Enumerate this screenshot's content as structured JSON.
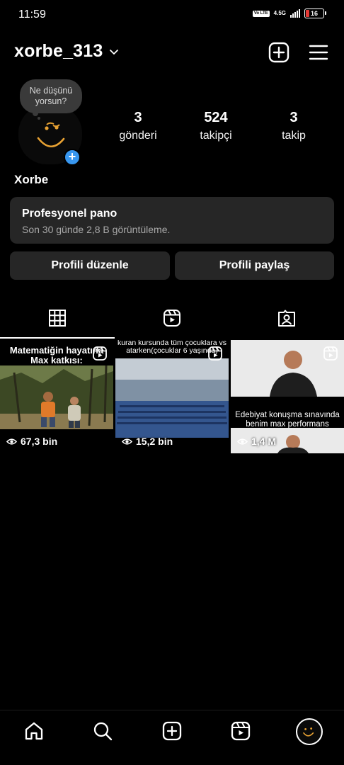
{
  "status": {
    "time": "11:59",
    "net_badge": "Vo LTE",
    "net_type": "4.5G",
    "battery": "16"
  },
  "header": {
    "username": "xorbe_313"
  },
  "profile": {
    "note": "Ne düşünü yorsun?",
    "display_name": "Xorbe",
    "stats": [
      {
        "value": "3",
        "label": "gönderi"
      },
      {
        "value": "524",
        "label": "takipçi"
      },
      {
        "value": "3",
        "label": "takip"
      }
    ]
  },
  "pro_dashboard": {
    "title": "Profesyonel pano",
    "subtitle": "Son 30 günde 2,8 B görüntüleme."
  },
  "buttons": {
    "edit": "Profili düzenle",
    "share": "Profili paylaş"
  },
  "tabs": [
    {
      "name": "grid",
      "icon": "grid-icon"
    },
    {
      "name": "reels",
      "icon": "reels-icon"
    },
    {
      "name": "tagged",
      "icon": "tagged-icon"
    }
  ],
  "posts": [
    {
      "caption_top": "Matematiğin hayatına Max katkısı:",
      "views": "67,3 bin"
    },
    {
      "caption_top": "kuran kursunda tüm çocuklara vs atarken(çocuklar 6 yaşında)",
      "views": "15,2 bin"
    },
    {
      "caption_bottom": "Edebiyat konuşma sınavında benim max performans",
      "views": "1,4 M"
    }
  ],
  "nav": [
    {
      "name": "home",
      "icon": "home-icon"
    },
    {
      "name": "search",
      "icon": "search-icon"
    },
    {
      "name": "create",
      "icon": "plus-square-icon"
    },
    {
      "name": "reels",
      "icon": "reels-icon"
    },
    {
      "name": "profile",
      "icon": "avatar"
    }
  ],
  "colors": {
    "accent": "#3897f0",
    "card": "#262626",
    "background": "#000000"
  }
}
